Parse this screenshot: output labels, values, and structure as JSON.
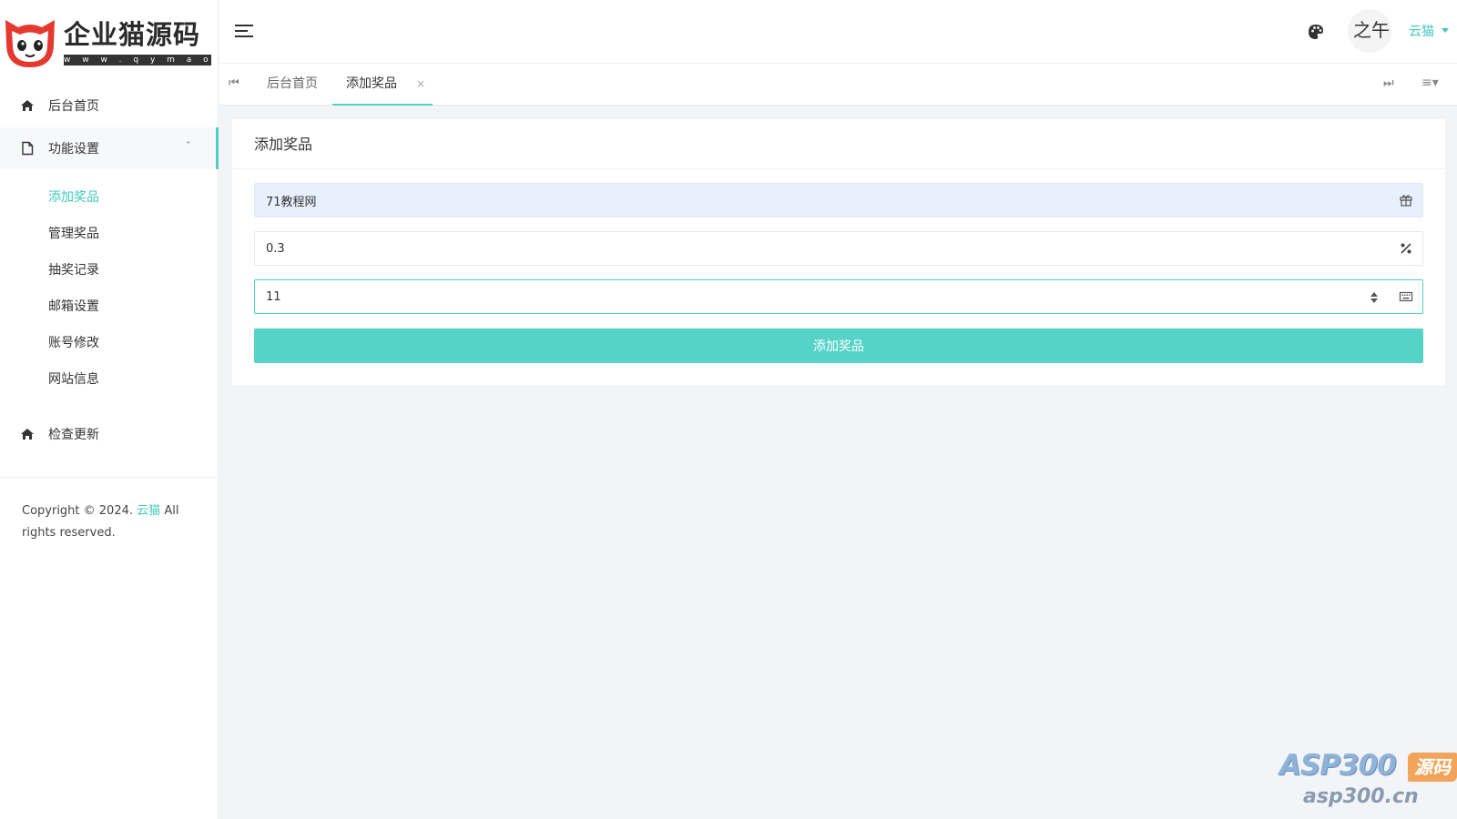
{
  "brand": {
    "name": "企业猫源码",
    "url": "w w w . q y m a o . c n"
  },
  "sidebar": {
    "items": [
      {
        "label": "后台首页",
        "icon": "home-icon"
      },
      {
        "label": "功能设置",
        "icon": "file-icon",
        "expanded": true
      },
      {
        "label": "检查更新",
        "icon": "home-icon"
      }
    ],
    "submenu": [
      {
        "label": "添加奖品",
        "active": true
      },
      {
        "label": "管理奖品"
      },
      {
        "label": "抽奖记录"
      },
      {
        "label": "邮箱设置"
      },
      {
        "label": "账号修改"
      },
      {
        "label": "网站信息"
      }
    ],
    "copyright_prefix": "Copyright © 2024.",
    "copyright_link": "云猫",
    "copyright_suffix": "All rights reserved."
  },
  "header": {
    "user_name": "云猫",
    "avatar_text": "之午"
  },
  "tabs": [
    {
      "label": "后台首页"
    },
    {
      "label": "添加奖品",
      "active": true,
      "close": "×"
    }
  ],
  "tab_controls": {
    "prev": "⏮",
    "next": "⏭",
    "menu": "≡▾"
  },
  "form": {
    "title": "添加奖品",
    "fields": [
      {
        "value": "71教程网",
        "suffix_icon": "gift-icon"
      },
      {
        "value": "0.3",
        "suffix_icon": "percent-icon"
      },
      {
        "value": "11",
        "suffix_icon": "keyboard-icon",
        "type": "number"
      }
    ],
    "submit_label": "添加奖品"
  },
  "watermark": {
    "main": "ASP300",
    "badge": "源码",
    "sub": "asp300.cn"
  },
  "colors": {
    "accent": "#4fd1c5",
    "button": "#55d3c7",
    "background": "#f2f4f8"
  }
}
